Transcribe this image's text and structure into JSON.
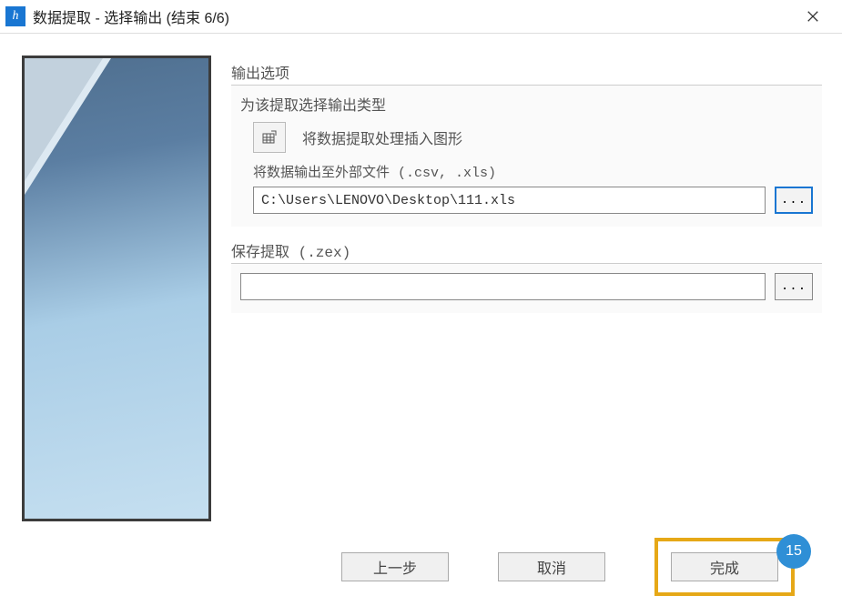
{
  "titlebar": {
    "title": "数据提取 - 选择输出 (结束 6/6)"
  },
  "output_options": {
    "group_title": "输出选项",
    "subtitle": "为该提取选择输出类型",
    "insert_label": "将数据提取处理插入图形",
    "export_label": "将数据输出至外部文件 (.csv, .xls)",
    "export_path": "C:\\Users\\LENOVO\\Desktop\\111.xls",
    "browse_label": "..."
  },
  "save_extract": {
    "group_title": "保存提取 (.zex)",
    "path": "",
    "browse_label": "..."
  },
  "footer": {
    "prev": "上一步",
    "cancel": "取消",
    "finish": "完成"
  },
  "hint": {
    "number": "15"
  }
}
